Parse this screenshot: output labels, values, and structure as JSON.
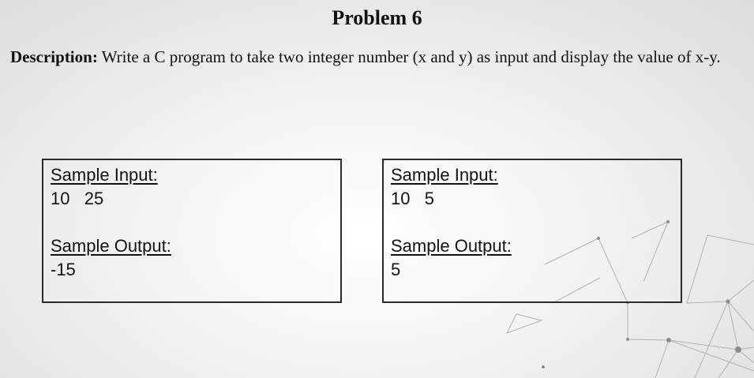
{
  "title": "Problem 6",
  "description": {
    "label": "Description:",
    "text": " Write a C program to take two integer number (x and y) as input and display the value of x-y."
  },
  "samples": [
    {
      "input_label": "Sample Input:",
      "input_value": "10   25",
      "output_label": "Sample Output:",
      "output_value": "-15"
    },
    {
      "input_label": "Sample Input:",
      "input_value": "10   5",
      "output_label": "Sample Output:",
      "output_value": "5"
    }
  ]
}
